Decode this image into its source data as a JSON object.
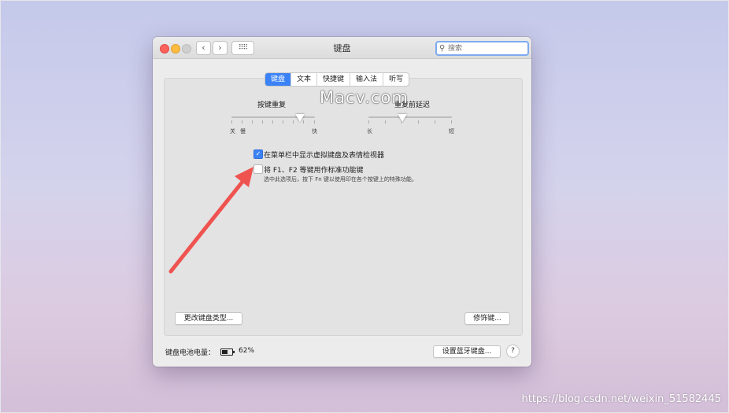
{
  "window": {
    "title": "键盘",
    "nav_back": "‹",
    "nav_forward": "›",
    "grid": "⠿⠿",
    "search_placeholder": "搜索"
  },
  "tabs": [
    {
      "label": "键盘",
      "active": true
    },
    {
      "label": "文本",
      "active": false
    },
    {
      "label": "快捷键",
      "active": false
    },
    {
      "label": "输入法",
      "active": false
    },
    {
      "label": "听写",
      "active": false
    }
  ],
  "key_repeat": {
    "label": "按键重复",
    "min_label": "关",
    "mid_label": "慢",
    "max_label": "快"
  },
  "repeat_delay": {
    "label": "重复前延迟",
    "min_label": "长",
    "max_label": "短"
  },
  "watermark": "Macv.com",
  "options": {
    "show_viewer": {
      "label": "在菜单栏中显示虚拟键盘及表情检视器",
      "checked": true
    },
    "fn_keys": {
      "label": "将 F1、F2 等键用作标准功能键",
      "checked": false,
      "description": "选中此选项后，按下 Fn 键以使用印在各个按键上的特殊功能。"
    }
  },
  "buttons": {
    "change_type": "更改键盘类型...",
    "modifier": "修饰键...",
    "bluetooth": "设置蓝牙键盘...",
    "help": "?"
  },
  "battery": {
    "label": "键盘电池电量：",
    "percent": "62%",
    "level": 0.62
  },
  "colors": {
    "accent": "#3b82f6",
    "arrow": "#ef5350"
  },
  "corner_watermark": "https://blog.csdn.net/weixin_51582445"
}
